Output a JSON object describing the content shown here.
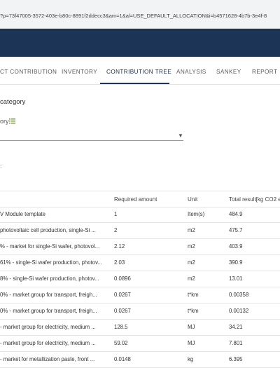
{
  "browser": {
    "url": "?p=73f47005-3572-403e-b80c-8891f2ddecc3&am=1&al=USE_DEFAULT_ALLOCATION&i=b4571628-4b7b-3e4f-8"
  },
  "tabs": [
    {
      "label": "CT CONTRIBUTION"
    },
    {
      "label": "INVENTORY"
    },
    {
      "label": "CONTRIBUTION TREE"
    },
    {
      "label": "ANALYSIS"
    },
    {
      "label": "SANKEY"
    },
    {
      "label": "REPORT"
    }
  ],
  "active_tab": "CONTRIBUTION TREE",
  "section": {
    "heading": "category",
    "subheading": "ory",
    "colon": ":"
  },
  "table": {
    "headers": [
      "",
      "Required amount",
      "Unit",
      "Total result[kg CO2 e"
    ],
    "rows": [
      [
        "V Module template",
        "1",
        "Item(s)",
        "484.9"
      ],
      [
        "photovoltaic cell production, single-Si ...",
        "2",
        "m2",
        "475.7"
      ],
      [
        "% - market for single-Si wafer, photovol...",
        "2.12",
        "m2",
        "403.9"
      ],
      [
        "61% - single-Si wafer production, photov...",
        "2.03",
        "m2",
        "390.9"
      ],
      [
        "8% - single-Si wafer production, photov...",
        "0.0896",
        "m2",
        "13.01"
      ],
      [
        "0% - market group for transport, freigh...",
        "0.0267",
        "t*km",
        "0.00358"
      ],
      [
        "0% - market group for transport, freigh...",
        "0.0267",
        "t*km",
        "0.00132"
      ],
      [
        "- market group for electricity, medium ...",
        "128.5",
        "MJ",
        "34.21"
      ],
      [
        "- market group for electricity, medium ...",
        "59.02",
        "MJ",
        "7.801"
      ],
      [
        "- market for metallization paste, front ...",
        "0.0148",
        "kg",
        "6.395"
      ]
    ]
  },
  "colors": {
    "appbar": "#1c3556",
    "accent": "#1c3556"
  }
}
